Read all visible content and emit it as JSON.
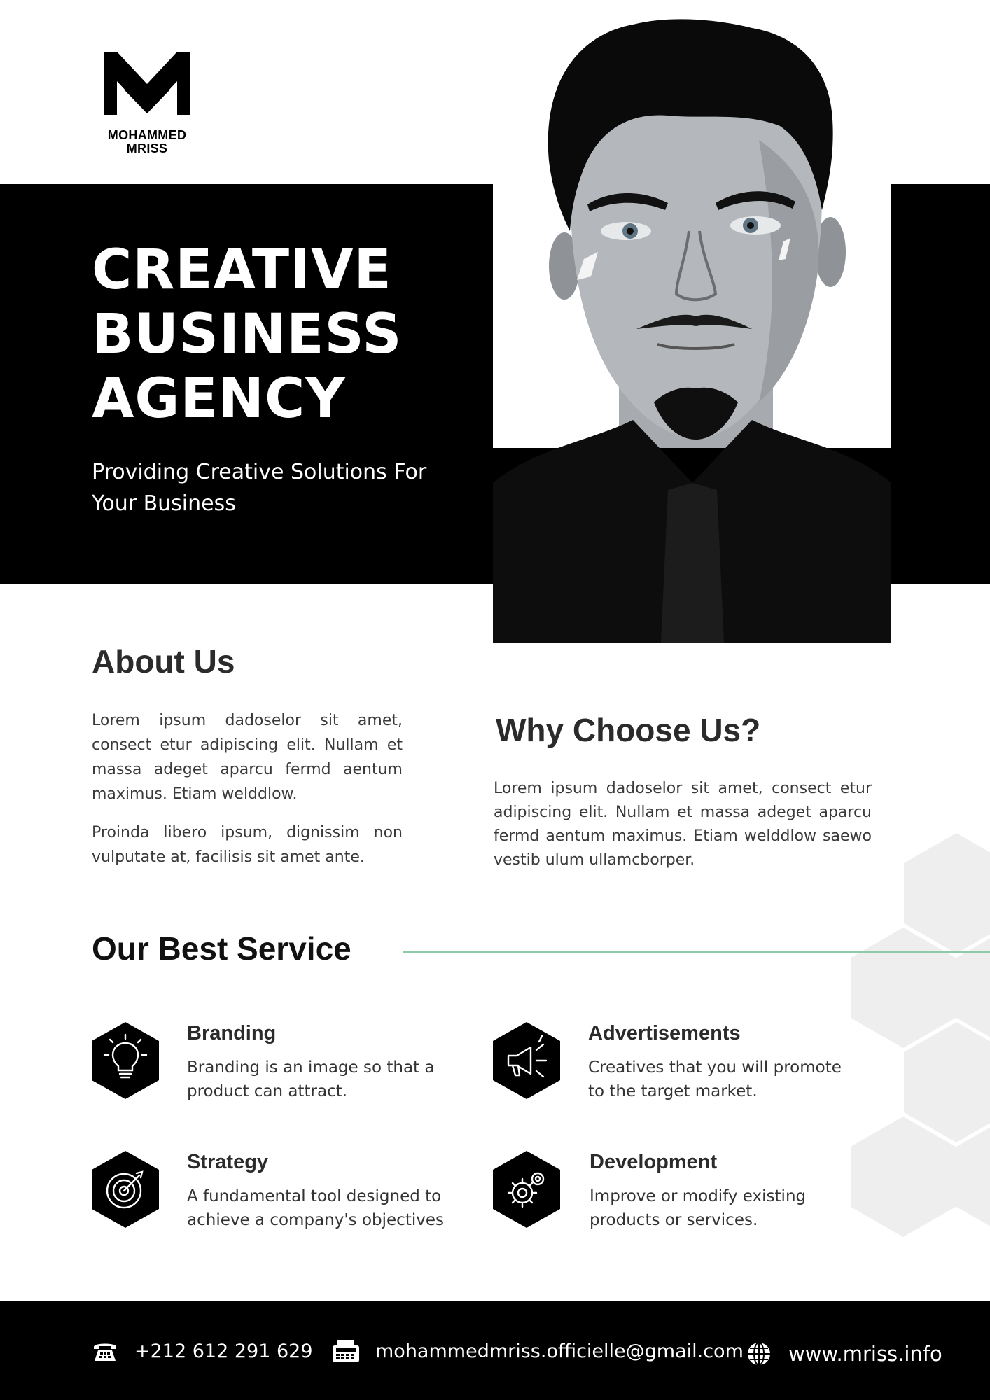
{
  "brand": {
    "logo_text": "MOHAMMED MRISS"
  },
  "hero": {
    "title": "CREATIVE BUSINESS AGENCY",
    "subtitle": "Providing Creative Solutions For Your Business"
  },
  "about": {
    "title": "About Us",
    "paragraph1": "Lorem ipsum dadoselor sit amet, consect etur adipiscing elit. Nullam et massa adeget aparcu fermd aentum maximus. Etiam welddlow.",
    "paragraph2": "Proinda libero ipsum, dignissim non vulputate at, facilisis sit amet ante."
  },
  "why": {
    "title": "Why Choose Us?",
    "paragraph": "Lorem ipsum dadoselor sit amet, consect etur adipiscing elit. Nullam et massa adeget aparcu fermd aentum maximus. Etiam welddlow saewo vestib ulum ullamcborper."
  },
  "services": {
    "title": "Our Best  Service",
    "accent_color": "#8fc9a6",
    "items": [
      {
        "icon": "lightbulb-icon",
        "title": "Branding",
        "description": "Branding is an image so that a product can attract."
      },
      {
        "icon": "megaphone-icon",
        "title": "Advertisements",
        "description": "Creatives that you will promote to the target market."
      },
      {
        "icon": "target-icon",
        "title": "Strategy",
        "description": "A fundamental tool designed to achieve a company's objectives"
      },
      {
        "icon": "gears-icon",
        "title": "Development",
        "description": "Improve or modify existing products or services."
      }
    ]
  },
  "footer": {
    "phone": "+212 612 291 629",
    "email": "mohammedmriss.officielle@gmail.com",
    "website": "www.mriss.info"
  },
  "colors": {
    "primary": "#000000",
    "text": "#2b2b2b",
    "hex_decoration": "#eeeeee"
  }
}
